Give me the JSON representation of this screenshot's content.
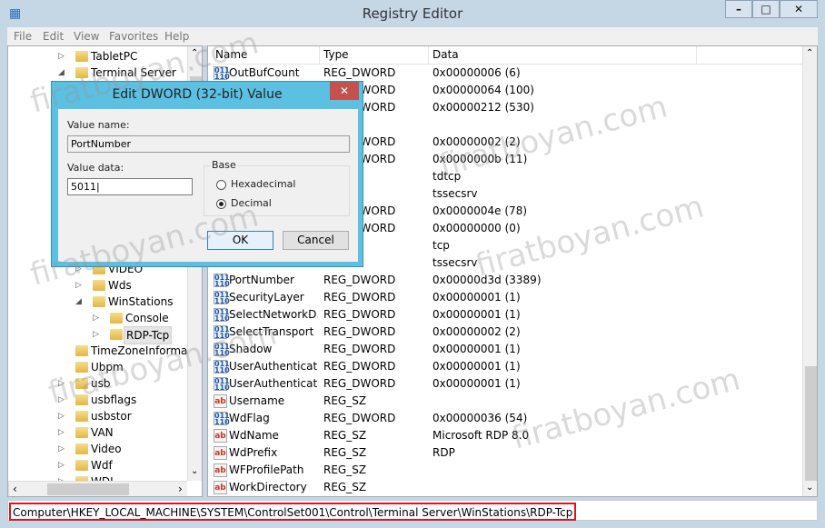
{
  "window": {
    "title": "Registry Editor",
    "controls": [
      "minimize",
      "maximize",
      "close"
    ]
  },
  "menu": [
    "File",
    "Edit",
    "View",
    "Favorites",
    "Help"
  ],
  "tree": {
    "items": [
      {
        "label": "TabletPC",
        "level": 0,
        "expander": "collapsed"
      },
      {
        "label": "Terminal Server",
        "level": 0,
        "expander": "expanded"
      },
      {
        "label": "VIDEO",
        "level": 1,
        "expander": "collapsed"
      },
      {
        "label": "Wds",
        "level": 1,
        "expander": "collapsed"
      },
      {
        "label": "WinStations",
        "level": 1,
        "expander": "expanded"
      },
      {
        "label": "Console",
        "level": 2,
        "expander": "collapsed"
      },
      {
        "label": "RDP-Tcp",
        "level": 2,
        "expander": "collapsed",
        "selected": true
      },
      {
        "label": "TimeZoneInformatic",
        "level": 0,
        "expander": "none"
      },
      {
        "label": "Ubpm",
        "level": 0,
        "expander": "none"
      },
      {
        "label": "usb",
        "level": 0,
        "expander": "collapsed"
      },
      {
        "label": "usbflags",
        "level": 0,
        "expander": "collapsed"
      },
      {
        "label": "usbstor",
        "level": 0,
        "expander": "collapsed"
      },
      {
        "label": "VAN",
        "level": 0,
        "expander": "collapsed"
      },
      {
        "label": "Video",
        "level": 0,
        "expander": "collapsed"
      },
      {
        "label": "Wdf",
        "level": 0,
        "expander": "collapsed"
      },
      {
        "label": "WDI",
        "level": 0,
        "expander": "collapsed"
      }
    ]
  },
  "list": {
    "columns": [
      "Name",
      "Type",
      "Data"
    ],
    "rows": [
      {
        "name": "OutBufCount",
        "type": "REG_DWORD",
        "data": "0x00000006 (6)",
        "icon": "dword"
      },
      {
        "name": "",
        "type": "REG_DWORD",
        "data": "0x00000064 (100)",
        "icon": "dword"
      },
      {
        "name": "",
        "type": "REG_DWORD",
        "data": "0x00000212 (530)",
        "icon": "dword"
      },
      {
        "name": "",
        "type": "",
        "data": "",
        "icon": ""
      },
      {
        "name": "",
        "type": "REG_DWORD",
        "data": "0x00000002 (2)",
        "icon": "dword"
      },
      {
        "name": "",
        "type": "REG_DWORD",
        "data": "0x0000000b (11)",
        "icon": "dword"
      },
      {
        "name": "",
        "type": "",
        "data": "tdtcp",
        "icon": ""
      },
      {
        "name": "",
        "type": "",
        "data": "tssecsrv",
        "icon": ""
      },
      {
        "name": "",
        "type": "REG_DWORD",
        "data": "0x0000004e (78)",
        "icon": "dword"
      },
      {
        "name": "",
        "type": "REG_DWORD",
        "data": "0x00000000 (0)",
        "icon": "dword"
      },
      {
        "name": "",
        "type": "",
        "data": "tcp",
        "icon": ""
      },
      {
        "name": "",
        "type": "",
        "data": "tssecsrv",
        "icon": ""
      },
      {
        "name": "PortNumber",
        "type": "REG_DWORD",
        "data": "0x00000d3d (3389)",
        "icon": "dword"
      },
      {
        "name": "SecurityLayer",
        "type": "REG_DWORD",
        "data": "0x00000001 (1)",
        "icon": "dword"
      },
      {
        "name": "SelectNetworkD...",
        "type": "REG_DWORD",
        "data": "0x00000001 (1)",
        "icon": "dword"
      },
      {
        "name": "SelectTransport",
        "type": "REG_DWORD",
        "data": "0x00000002 (2)",
        "icon": "dword"
      },
      {
        "name": "Shadow",
        "type": "REG_DWORD",
        "data": "0x00000001 (1)",
        "icon": "dword"
      },
      {
        "name": "UserAuthenticat...",
        "type": "REG_DWORD",
        "data": "0x00000001 (1)",
        "icon": "dword"
      },
      {
        "name": "UserAuthenticat...",
        "type": "REG_DWORD",
        "data": "0x00000001 (1)",
        "icon": "dword"
      },
      {
        "name": "Username",
        "type": "REG_SZ",
        "data": "",
        "icon": "sz"
      },
      {
        "name": "WdFlag",
        "type": "REG_DWORD",
        "data": "0x00000036 (54)",
        "icon": "dword"
      },
      {
        "name": "WdName",
        "type": "REG_SZ",
        "data": "Microsoft RDP 8.0",
        "icon": "sz"
      },
      {
        "name": "WdPrefix",
        "type": "REG_SZ",
        "data": "RDP",
        "icon": "sz"
      },
      {
        "name": "WFProfilePath",
        "type": "REG_SZ",
        "data": "",
        "icon": "sz"
      },
      {
        "name": "WorkDirectory",
        "type": "REG_SZ",
        "data": "",
        "icon": "sz"
      }
    ]
  },
  "status": {
    "path": "Computer\\HKEY_LOCAL_MACHINE\\SYSTEM\\ControlSet001\\Control\\Terminal Server\\WinStations\\RDP-Tcp",
    "highlight_color": "#e0141e"
  },
  "dialog": {
    "title": "Edit DWORD (32-bit) Value",
    "value_name_label": "Value name:",
    "value_name": "PortNumber",
    "value_data_label": "Value data:",
    "value_data": "5011",
    "base_label": "Base",
    "base_options": [
      "Hexadecimal",
      "Decimal"
    ],
    "base_selected": "Decimal",
    "ok": "OK",
    "cancel": "Cancel"
  },
  "watermark": "firatboyan.com"
}
